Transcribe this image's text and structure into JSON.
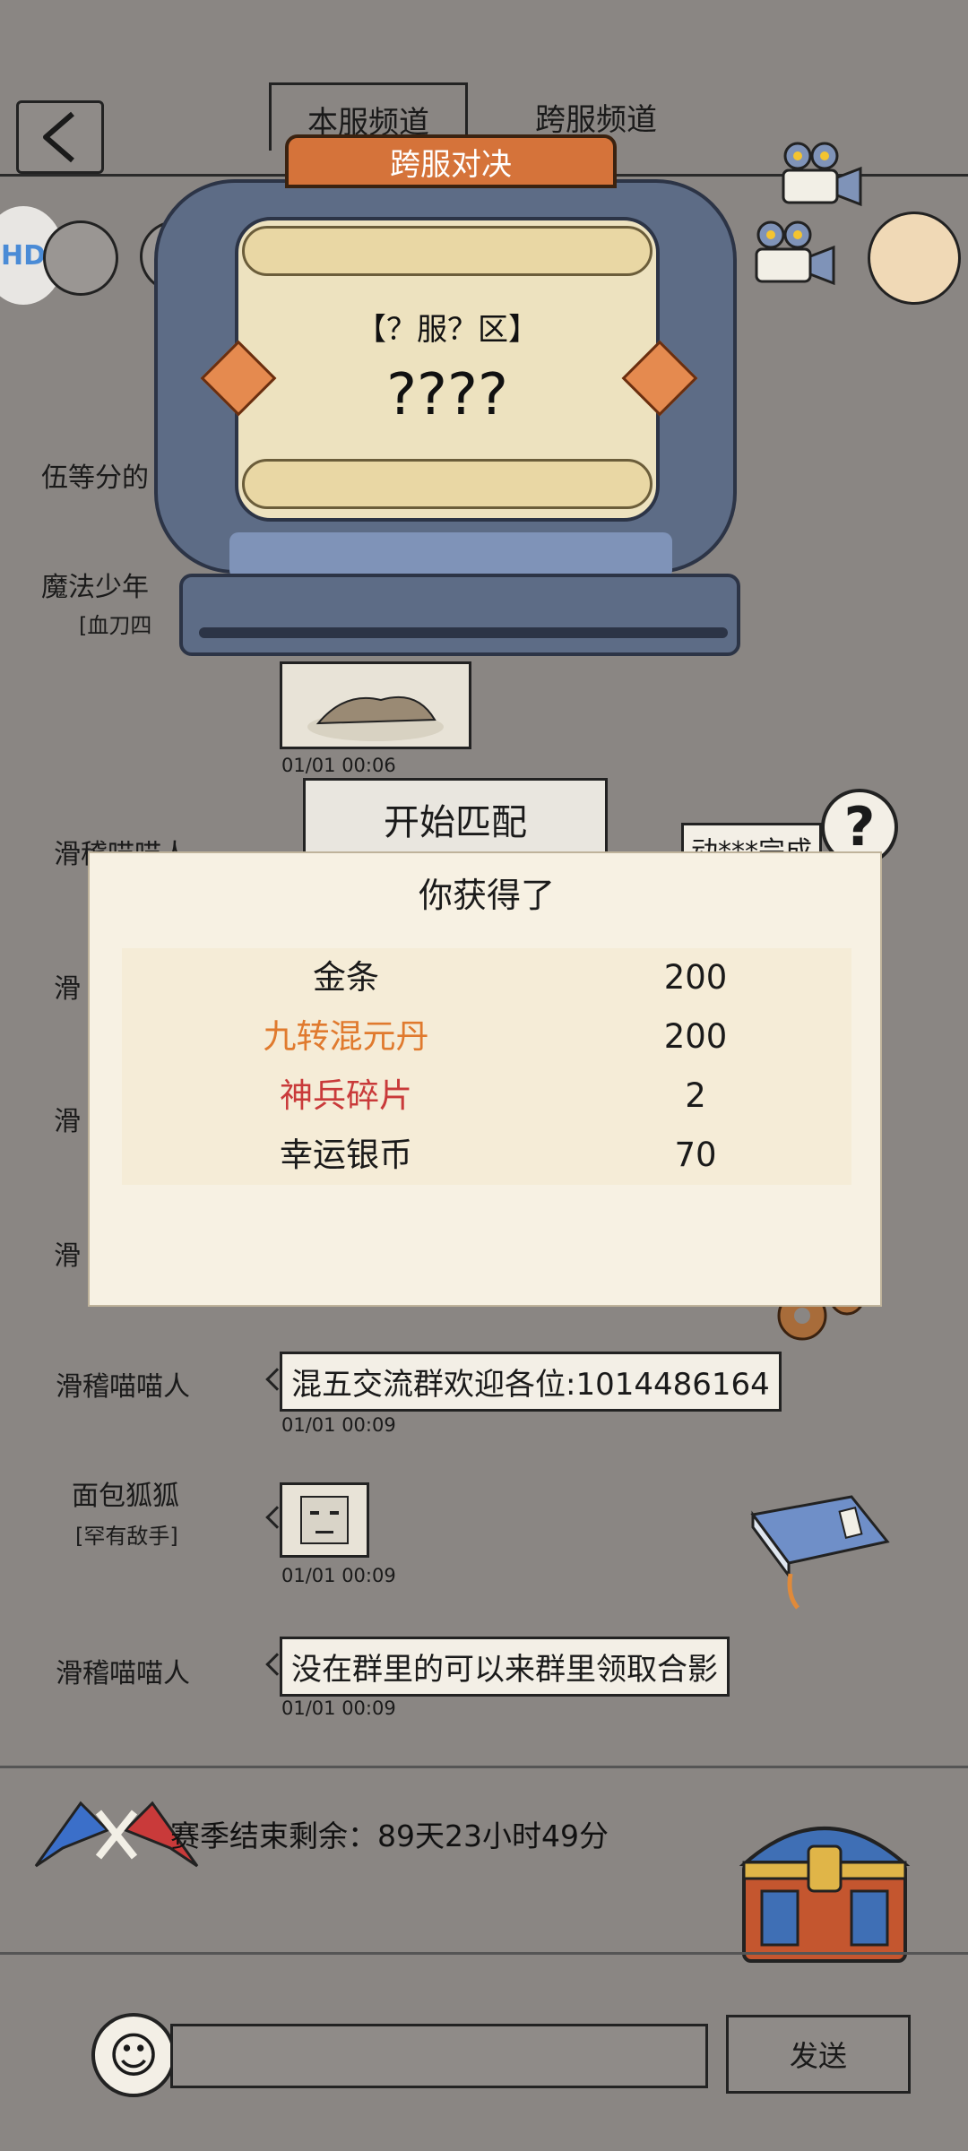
{
  "channels": {
    "local": "本服频道",
    "cross": "跨服频道"
  },
  "machine": {
    "title": "跨服对决",
    "server_label": "【？服？区】",
    "mystery": "????",
    "match_button": "开始匹配"
  },
  "chat": [
    {
      "name": "伍等分的",
      "sub": "",
      "time": ""
    },
    {
      "name": "魔法少年",
      "sub": "[血刀四",
      "time": "01/01 00:06"
    },
    {
      "name": "滑稽喵喵人",
      "sub": "",
      "time": "",
      "text": "动***完成"
    },
    {
      "name": "滑",
      "sub": "",
      "time": ""
    },
    {
      "name": "滑",
      "sub": "",
      "time": ""
    },
    {
      "name": "滑",
      "sub": "",
      "time": ""
    },
    {
      "name": "滑稽喵喵人",
      "sub": "",
      "time": "01/01 00:09",
      "text": "混五交流群欢迎各位:1014486164"
    },
    {
      "name": "面包狐狐",
      "sub": "[罕有敌手]",
      "time": "01/01 00:09"
    },
    {
      "name": "滑稽喵喵人",
      "sub": "",
      "time": "01/01 00:09",
      "text": "没在群里的可以来群里领取合影"
    }
  ],
  "reward": {
    "title": "你获得了",
    "items": [
      {
        "name": "金条",
        "qty": "200",
        "color": "#1a1a1a"
      },
      {
        "name": "九转混元丹",
        "qty": "200",
        "color": "#e07a2e"
      },
      {
        "name": "神兵碎片",
        "qty": "2",
        "color": "#c93a3a"
      },
      {
        "name": "幸运银币",
        "qty": "70",
        "color": "#1a1a1a"
      }
    ]
  },
  "season": {
    "text": "赛季结束剩余：89天23小时49分"
  },
  "input": {
    "send_label": "发送"
  },
  "icons": {
    "back": "back-arrow-icon",
    "camera": "camera-icon",
    "help": "help-icon",
    "emoji": "smiley-emoji-icon",
    "chest": "treasure-chest-icon",
    "scroll": "scroll-book-icon",
    "gear": "gear-icon",
    "vs": "versus-logo-icon"
  }
}
